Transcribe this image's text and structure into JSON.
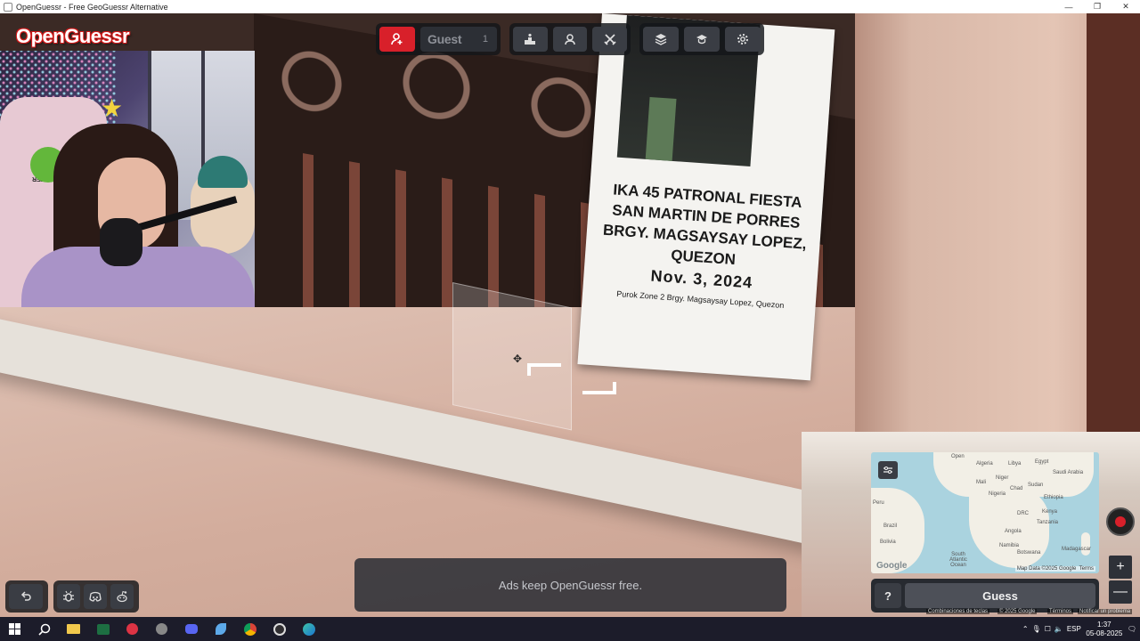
{
  "window": {
    "title": "OpenGuessr - Free GeoGuessr Alternative",
    "minimize": "—",
    "maximize": "❐",
    "close": "✕"
  },
  "logo": "OpenGuessr",
  "toolbar": {
    "player_name": "Guest",
    "player_count": "1",
    "icons": [
      "add-user-icon",
      "podium-icon",
      "party-icon",
      "versus-icon",
      "layers-icon",
      "graduation-icon",
      "gear-icon"
    ]
  },
  "poster": {
    "line1": "IKA 45 PATRONAL FIESTA",
    "line2": "SAN MARTIN DE PORRES",
    "line3": "BRGY. MAGSAYSAY LOPEZ, QUEZON",
    "line4": "Nov. 3, 2024",
    "line5": "Purok Zone 2 Brgy. Magsaysay Lopez, Quezon"
  },
  "webcam": {
    "chair_brand": "DPRESTER"
  },
  "ads_text": "Ads keep OpenGuessr free.",
  "minimap": {
    "labels": [
      "Algeria",
      "Libya",
      "Egypt",
      "Saudi Arabia",
      "Mali",
      "Niger",
      "Sudan",
      "Chad",
      "Nigeria",
      "Ethiopia",
      "DRC",
      "Kenya",
      "Tanzania",
      "Angola",
      "Namibia",
      "Botswana",
      "Madagascar",
      "Brazil",
      "Bolivia",
      "Peru",
      "South Atlantic Ocean",
      "Open"
    ],
    "google": "Google",
    "attribution": "Map Data ©2025 Google",
    "terms": "Terms"
  },
  "guess": {
    "help": "?",
    "button": "Guess"
  },
  "zoom": {
    "in": "+",
    "out": "—"
  },
  "google_footer": {
    "shortcuts": "Combinaciones de teclas",
    "data": "© 2025 Google",
    "terms": "Términos",
    "report": "Notificar un problema"
  },
  "taskbar": {
    "language": "ESP",
    "time": "1:37",
    "date": "05-08-2025"
  }
}
